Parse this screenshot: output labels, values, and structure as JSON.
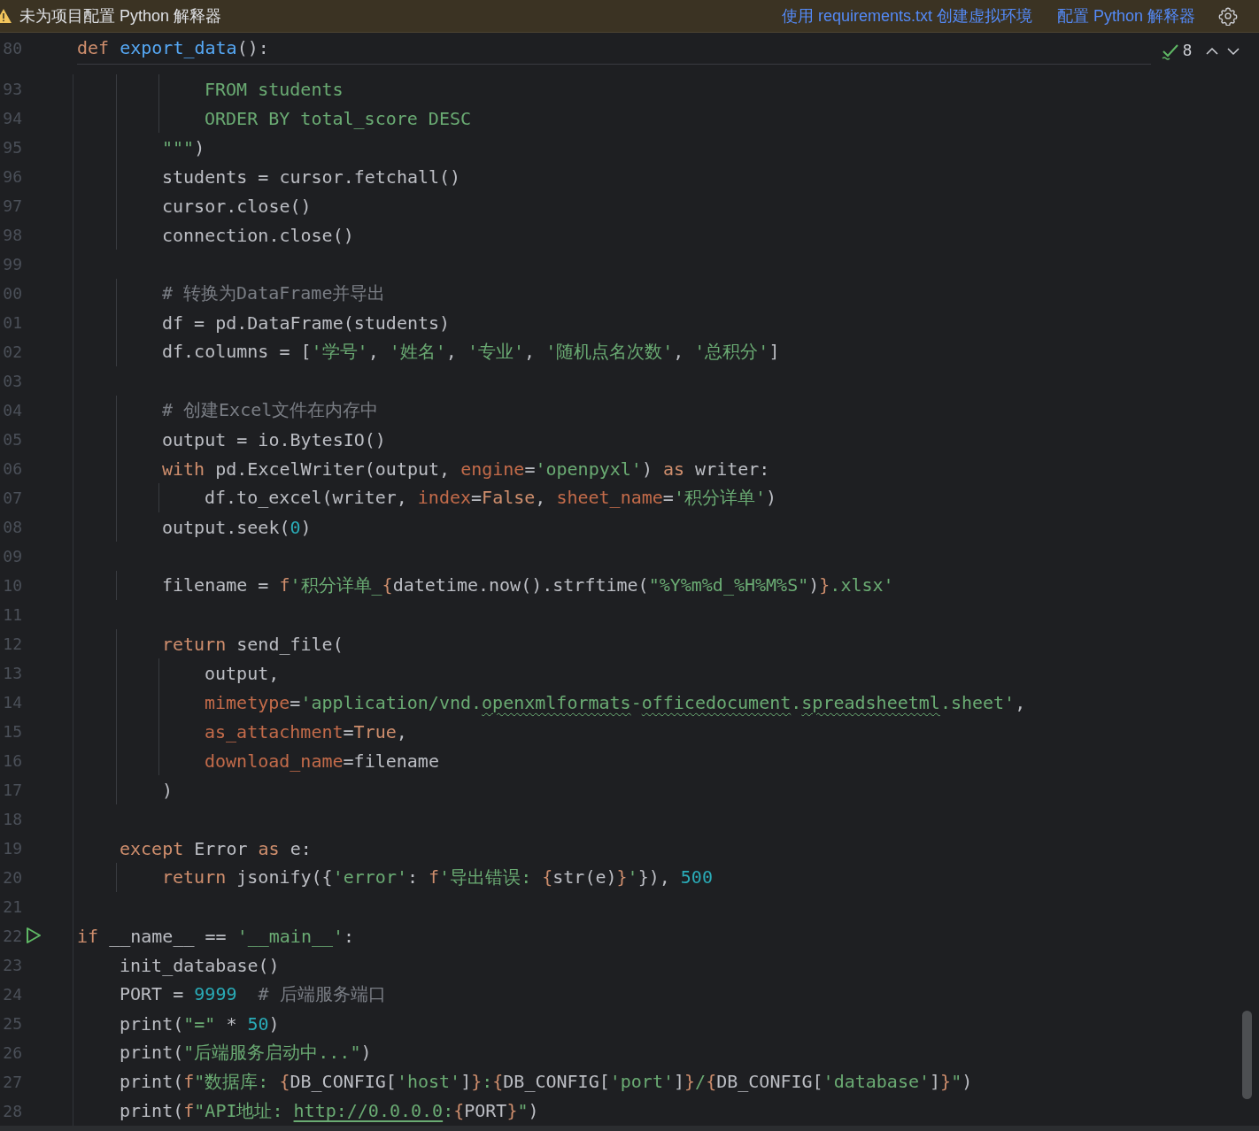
{
  "banner": {
    "message": "未为项目配置 Python 解释器",
    "actions": [
      "使用 requirements.txt 创建虚拟环境",
      "配置 Python 解释器"
    ]
  },
  "sticky_header": {
    "line_number": "80",
    "tokens": [
      {
        "text": "def ",
        "kind": "keyword"
      },
      {
        "text": "export_data",
        "kind": "function"
      },
      {
        "text": "():",
        "kind": "plain"
      }
    ]
  },
  "inspections": {
    "count": "8"
  },
  "lines": [
    {
      "number": "93",
      "tokens": [
        {
          "text": "            FROM students",
          "kind": "string"
        }
      ]
    },
    {
      "number": "94",
      "tokens": [
        {
          "text": "            ORDER BY total_score DESC",
          "kind": "string"
        }
      ]
    },
    {
      "number": "95",
      "tokens": [
        {
          "text": "        \"\"\"",
          "kind": "string"
        },
        {
          "text": ")",
          "kind": "plain"
        }
      ]
    },
    {
      "number": "96",
      "tokens": [
        {
          "text": "        students = cursor.fetchall()",
          "kind": "plain"
        }
      ]
    },
    {
      "number": "97",
      "tokens": [
        {
          "text": "        cursor.close()",
          "kind": "plain"
        }
      ]
    },
    {
      "number": "98",
      "tokens": [
        {
          "text": "        connection.close()",
          "kind": "plain"
        }
      ]
    },
    {
      "number": "99"
    },
    {
      "number": "00",
      "tokens": [
        {
          "text": "        # 转换为DataFrame并导出",
          "kind": "comment"
        }
      ]
    },
    {
      "number": "01",
      "tokens": [
        {
          "text": "        df = pd.DataFrame(students)",
          "kind": "plain"
        }
      ]
    },
    {
      "number": "02",
      "tokens": [
        {
          "text": "        df.columns = [",
          "kind": "plain"
        },
        {
          "text": "'学号'",
          "kind": "string"
        },
        {
          "text": ", ",
          "kind": "plain"
        },
        {
          "text": "'姓名'",
          "kind": "string"
        },
        {
          "text": ", ",
          "kind": "plain"
        },
        {
          "text": "'专业'",
          "kind": "string"
        },
        {
          "text": ", ",
          "kind": "plain"
        },
        {
          "text": "'随机点名次数'",
          "kind": "string"
        },
        {
          "text": ", ",
          "kind": "plain"
        },
        {
          "text": "'总积分'",
          "kind": "string"
        },
        {
          "text": "]",
          "kind": "plain"
        }
      ]
    },
    {
      "number": "03"
    },
    {
      "number": "04",
      "tokens": [
        {
          "text": "        # 创建Excel文件在内存中",
          "kind": "comment"
        }
      ]
    },
    {
      "number": "05",
      "tokens": [
        {
          "text": "        output = io.BytesIO()",
          "kind": "plain"
        }
      ]
    },
    {
      "number": "06",
      "tokens": [
        {
          "text": "        with",
          "kind": "keyword"
        },
        {
          "text": " pd.ExcelWriter(output, ",
          "kind": "plain"
        },
        {
          "text": "engine",
          "kind": "argument"
        },
        {
          "text": "=",
          "kind": "plain"
        },
        {
          "text": "'openpyxl'",
          "kind": "string"
        },
        {
          "text": ") ",
          "kind": "plain"
        },
        {
          "text": "as",
          "kind": "keyword"
        },
        {
          "text": " writer:",
          "kind": "plain"
        }
      ]
    },
    {
      "number": "07",
      "tokens": [
        {
          "text": "            df.to_excel(writer, ",
          "kind": "plain"
        },
        {
          "text": "index",
          "kind": "argument"
        },
        {
          "text": "=",
          "kind": "plain"
        },
        {
          "text": "False",
          "kind": "keyword"
        },
        {
          "text": ", ",
          "kind": "plain"
        },
        {
          "text": "sheet_name",
          "kind": "argument"
        },
        {
          "text": "=",
          "kind": "plain"
        },
        {
          "text": "'积分详单'",
          "kind": "string"
        },
        {
          "text": ")",
          "kind": "plain"
        }
      ]
    },
    {
      "number": "08",
      "tokens": [
        {
          "text": "        output.seek(",
          "kind": "plain"
        },
        {
          "text": "0",
          "kind": "number"
        },
        {
          "text": ")",
          "kind": "plain"
        }
      ]
    },
    {
      "number": "09"
    },
    {
      "number": "10",
      "tokens": [
        {
          "text": "        filename = ",
          "kind": "plain"
        },
        {
          "text": "f",
          "kind": "keyword"
        },
        {
          "text": "'积分详单_",
          "kind": "string"
        },
        {
          "text": "{",
          "kind": "brace"
        },
        {
          "text": "datetime.now().strftime(",
          "kind": "plain"
        },
        {
          "text": "\"%Y%m%d_%H%M%S\"",
          "kind": "string"
        },
        {
          "text": ")",
          "kind": "plain"
        },
        {
          "text": "}",
          "kind": "brace"
        },
        {
          "text": ".xlsx'",
          "kind": "string"
        }
      ]
    },
    {
      "number": "11"
    },
    {
      "number": "12",
      "tokens": [
        {
          "text": "        return",
          "kind": "keyword"
        },
        {
          "text": " send_file(",
          "kind": "plain"
        }
      ]
    },
    {
      "number": "13",
      "tokens": [
        {
          "text": "            output,",
          "kind": "plain"
        }
      ]
    },
    {
      "number": "14",
      "tokens": [
        {
          "text": "            mimetype",
          "kind": "argument"
        },
        {
          "text": "=",
          "kind": "plain"
        },
        {
          "text": "'application/vnd.",
          "kind": "string"
        },
        {
          "text": "openxmlformats",
          "kind": "typo"
        },
        {
          "text": "-",
          "kind": "string"
        },
        {
          "text": "officedocument",
          "kind": "typo"
        },
        {
          "text": ".",
          "kind": "string"
        },
        {
          "text": "spreadsheetml",
          "kind": "typo"
        },
        {
          "text": ".sheet'",
          "kind": "string"
        },
        {
          "text": ",",
          "kind": "plain"
        }
      ]
    },
    {
      "number": "15",
      "tokens": [
        {
          "text": "            as_attachment",
          "kind": "argument"
        },
        {
          "text": "=",
          "kind": "plain"
        },
        {
          "text": "True",
          "kind": "keyword"
        },
        {
          "text": ",",
          "kind": "plain"
        }
      ]
    },
    {
      "number": "16",
      "tokens": [
        {
          "text": "            download_name",
          "kind": "argument"
        },
        {
          "text": "=filename",
          "kind": "plain"
        }
      ]
    },
    {
      "number": "17",
      "tokens": [
        {
          "text": "        )",
          "kind": "plain"
        }
      ]
    },
    {
      "number": "18"
    },
    {
      "number": "19",
      "tokens": [
        {
          "text": "    except",
          "kind": "keyword"
        },
        {
          "text": " Error ",
          "kind": "plain"
        },
        {
          "text": "as",
          "kind": "keyword"
        },
        {
          "text": " e:",
          "kind": "plain"
        }
      ]
    },
    {
      "number": "20",
      "tokens": [
        {
          "text": "        return",
          "kind": "keyword"
        },
        {
          "text": " jsonify({",
          "kind": "plain"
        },
        {
          "text": "'error'",
          "kind": "string"
        },
        {
          "text": ": ",
          "kind": "plain"
        },
        {
          "text": "f",
          "kind": "keyword"
        },
        {
          "text": "'导出错误: ",
          "kind": "string"
        },
        {
          "text": "{",
          "kind": "brace"
        },
        {
          "text": "str(e)",
          "kind": "plain"
        },
        {
          "text": "}",
          "kind": "brace"
        },
        {
          "text": "'",
          "kind": "string"
        },
        {
          "text": "}), ",
          "kind": "plain"
        },
        {
          "text": "500",
          "kind": "number"
        }
      ]
    },
    {
      "number": "21"
    },
    {
      "number": "22",
      "run_marker": true,
      "tokens": [
        {
          "text": "if",
          "kind": "keyword"
        },
        {
          "text": " __name__ == ",
          "kind": "plain"
        },
        {
          "text": "'__main__'",
          "kind": "string"
        },
        {
          "text": ":",
          "kind": "plain"
        }
      ]
    },
    {
      "number": "23",
      "tokens": [
        {
          "text": "    init_database()",
          "kind": "plain"
        }
      ]
    },
    {
      "number": "24",
      "tokens": [
        {
          "text": "    PORT = ",
          "kind": "plain"
        },
        {
          "text": "9999",
          "kind": "number"
        },
        {
          "text": "  # 后端服务端口",
          "kind": "comment"
        }
      ]
    },
    {
      "number": "25",
      "tokens": [
        {
          "text": "    print(",
          "kind": "plain"
        },
        {
          "text": "\"=\"",
          "kind": "string"
        },
        {
          "text": " * ",
          "kind": "plain"
        },
        {
          "text": "50",
          "kind": "number"
        },
        {
          "text": ")",
          "kind": "plain"
        }
      ]
    },
    {
      "number": "26",
      "tokens": [
        {
          "text": "    print(",
          "kind": "plain"
        },
        {
          "text": "\"后端服务启动中...\"",
          "kind": "string"
        },
        {
          "text": ")",
          "kind": "plain"
        }
      ]
    },
    {
      "number": "27",
      "tokens": [
        {
          "text": "    print(",
          "kind": "plain"
        },
        {
          "text": "f",
          "kind": "keyword"
        },
        {
          "text": "\"数据库: ",
          "kind": "string"
        },
        {
          "text": "{",
          "kind": "brace"
        },
        {
          "text": "DB_CONFIG[",
          "kind": "plain"
        },
        {
          "text": "'host'",
          "kind": "string"
        },
        {
          "text": "]",
          "kind": "plain"
        },
        {
          "text": "}",
          "kind": "brace"
        },
        {
          "text": ":",
          "kind": "string"
        },
        {
          "text": "{",
          "kind": "brace"
        },
        {
          "text": "DB_CONFIG[",
          "kind": "plain"
        },
        {
          "text": "'port'",
          "kind": "string"
        },
        {
          "text": "]",
          "kind": "plain"
        },
        {
          "text": "}",
          "kind": "brace"
        },
        {
          "text": "/",
          "kind": "string"
        },
        {
          "text": "{",
          "kind": "brace"
        },
        {
          "text": "DB_CONFIG[",
          "kind": "plain"
        },
        {
          "text": "'database'",
          "kind": "string"
        },
        {
          "text": "]",
          "kind": "plain"
        },
        {
          "text": "}",
          "kind": "brace"
        },
        {
          "text": "\"",
          "kind": "string"
        },
        {
          "text": ")",
          "kind": "plain"
        }
      ]
    },
    {
      "number": "28",
      "tokens": [
        {
          "text": "    print(",
          "kind": "plain"
        },
        {
          "text": "f",
          "kind": "keyword"
        },
        {
          "text": "\"API地址: ",
          "kind": "string"
        },
        {
          "text": "http://0.0.0.0",
          "kind": "link"
        },
        {
          "text": ":",
          "kind": "string"
        },
        {
          "text": "{",
          "kind": "brace"
        },
        {
          "text": "PORT",
          "kind": "plain"
        },
        {
          "text": "}",
          "kind": "brace"
        },
        {
          "text": "\"",
          "kind": "string"
        },
        {
          "text": ")",
          "kind": "plain"
        }
      ]
    }
  ]
}
